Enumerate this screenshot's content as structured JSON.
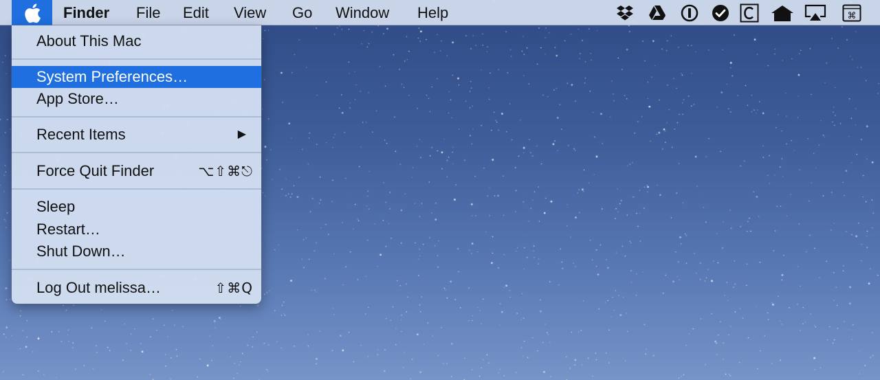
{
  "menubar": {
    "active_app": "Finder",
    "menus": [
      "File",
      "Edit",
      "View",
      "Go",
      "Window",
      "Help"
    ],
    "status_icons": [
      "dropbox-icon",
      "google-drive-icon",
      "1password-icon",
      "checkmark-circle-icon",
      "c-box-icon",
      "home-icon",
      "airplay-icon",
      "command-key-icon"
    ],
    "accent_color": "#1f6fe0"
  },
  "apple_menu": {
    "items": [
      {
        "label": "About This Mac",
        "shortcut": ""
      },
      {
        "label": "System Preferences…",
        "shortcut": "",
        "highlighted": true
      },
      {
        "label": "App Store…",
        "shortcut": ""
      },
      {
        "label": "Recent Items",
        "shortcut": "",
        "submenu": true,
        "arrow": "▶"
      },
      {
        "label": "Force Quit Finder",
        "shortcut": "⌥⇧⌘⎋"
      },
      {
        "label": "Sleep",
        "shortcut": ""
      },
      {
        "label": "Restart…",
        "shortcut": ""
      },
      {
        "label": "Shut Down…",
        "shortcut": ""
      },
      {
        "label": "Log Out melissa…",
        "shortcut": "⇧⌘Q"
      }
    ]
  }
}
